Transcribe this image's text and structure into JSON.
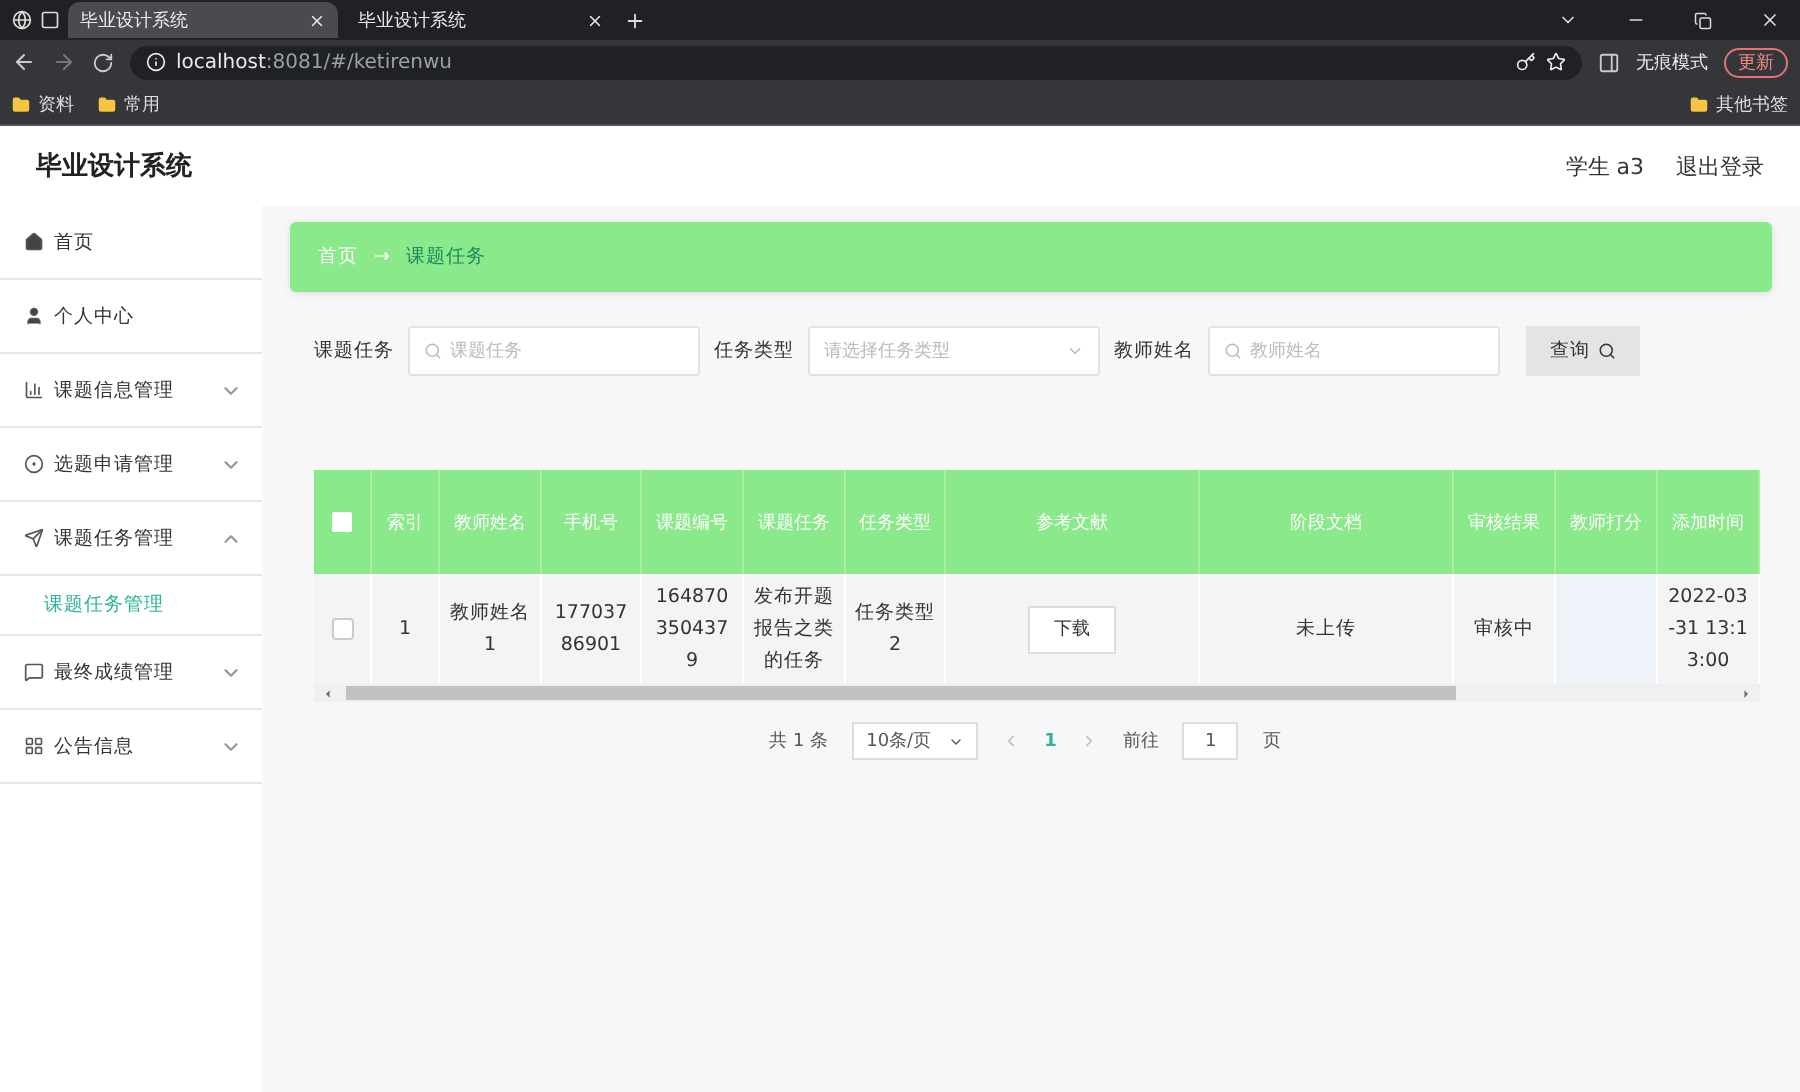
{
  "browser": {
    "tabs": [
      {
        "title": "毕业设计系统",
        "selected": true
      },
      {
        "title": "毕业设计系统",
        "selected": false
      }
    ],
    "url_host": "localhost",
    "url_rest": ":8081/#/ketirenwu",
    "profile": "无痕模式",
    "update_button": "更新",
    "bookmarks": [
      "资料",
      "常用"
    ],
    "other_bookmarks": "其他书签"
  },
  "app": {
    "title": "毕业设计系统",
    "user": "学生 a3",
    "logout": "退出登录"
  },
  "sidebar": {
    "items": [
      {
        "label": "首页"
      },
      {
        "label": "个人中心"
      },
      {
        "label": "课题信息管理",
        "expanded": false
      },
      {
        "label": "选题申请管理",
        "expanded": false
      },
      {
        "label": "课题任务管理",
        "expanded": true,
        "children": [
          {
            "label": "课题任务管理",
            "selected": true
          }
        ]
      },
      {
        "label": "最终成绩管理",
        "expanded": false
      },
      {
        "label": "公告信息",
        "expanded": false
      }
    ]
  },
  "breadcrumb": [
    "首页",
    "→",
    "课题任务"
  ],
  "search": [
    {
      "label": "课题任务",
      "kind": "input",
      "placeholder": "课题任务"
    },
    {
      "label": "任务类型",
      "kind": "select",
      "placeholder": "请选择任务类型"
    },
    {
      "label": "教师姓名",
      "kind": "input",
      "placeholder": "教师姓名"
    }
  ],
  "search_button": "查询",
  "table": {
    "select_all_checked": false,
    "columns": [
      "索引",
      "教师姓名",
      "手机号",
      "课题编号",
      "课题任务",
      "任务类型",
      "参考文献",
      "阶段文档",
      "审核结果",
      "教师打分",
      "添加时间"
    ],
    "rows": [
      {
        "checked": false,
        "cells": [
          "1",
          "教师姓名1",
          "17703786901",
          "1648703504379",
          "发布开题报告之类的任务",
          "任务类型2",
          {
            "button": "下载"
          },
          "未上传",
          "审核中",
          "",
          "2022-03-31 13:13:00"
        ]
      }
    ]
  },
  "pagination": {
    "total": "共 1 条",
    "page_size": "10条/页",
    "pages": [
      {
        "label": "1",
        "selected": true
      }
    ],
    "goto_label": "前往",
    "goto_value": "1",
    "goto_suffix": "页"
  }
}
